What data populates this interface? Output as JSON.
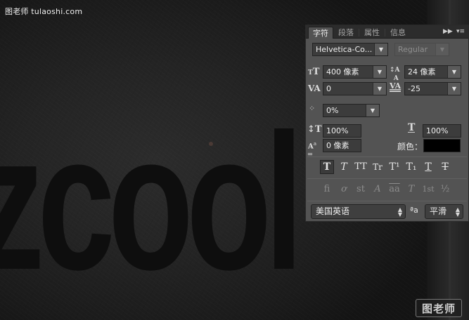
{
  "watermark": {
    "top": "图老师 tulaoshi.com",
    "logo": "图老师"
  },
  "canvas_text": "zcool",
  "panel": {
    "tabs": [
      "字符",
      "段落",
      "属性",
      "信息"
    ],
    "font_family": "Helvetica-Co...",
    "font_style": "Regular",
    "font_size": "400 像素",
    "leading": "24 像素",
    "kerning": "0",
    "tracking": "-25",
    "tsume": "0%",
    "vertical_scale": "100%",
    "horizontal_scale": "100%",
    "baseline_shift": "0 像素",
    "color_label": "颜色：",
    "color": "#000000",
    "format_buttons": [
      "T",
      "T",
      "TT",
      "Tr",
      "T¹",
      "T₁",
      "T",
      "T"
    ],
    "opentype_buttons": [
      "fi",
      "ơ",
      "st",
      "A",
      "aa",
      "T",
      "1st",
      "½"
    ],
    "language": "美国英语",
    "aa_label": "ªa",
    "antialias": "平滑"
  }
}
